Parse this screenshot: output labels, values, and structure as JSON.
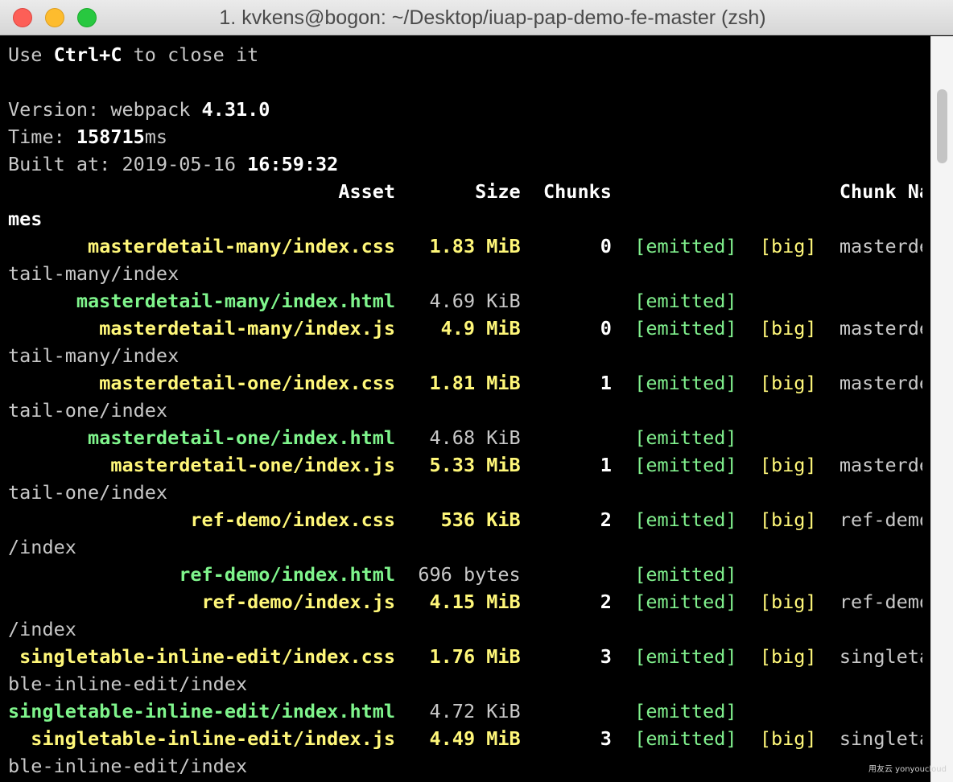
{
  "window": {
    "title": "1. kvkens@bogon: ~/Desktop/iuap-pap-demo-fe-master (zsh)"
  },
  "terminal": {
    "intro": {
      "pre": "Use ",
      "key": "Ctrl+C",
      "post": " to close it"
    },
    "version": {
      "label": "Version: webpack ",
      "value": "4.31.0"
    },
    "time": {
      "label": "Time: ",
      "value": "158715",
      "unit": "ms"
    },
    "built": {
      "label": "Built at: 2019-05-16 ",
      "value": "16:59:32"
    },
    "headers": {
      "asset": "Asset",
      "size": "Size",
      "chunks": "Chunks",
      "chunk_names": "Chunk Na",
      "chunk_names_wrap": "mes"
    },
    "rows": [
      {
        "asset": "masterdetail-many/index.css",
        "size": "1.83 MiB",
        "chunk": "0",
        "emitted": "[emitted]",
        "big": "[big]",
        "name": "masterde",
        "wrap": "tail-many/index",
        "type": "css"
      },
      {
        "asset": "masterdetail-many/index.html",
        "size": "4.69 KiB",
        "chunk": "",
        "emitted": "[emitted]",
        "big": "",
        "name": "",
        "wrap": "",
        "type": "html"
      },
      {
        "asset": "masterdetail-many/index.js",
        "size": "4.9 MiB",
        "chunk": "0",
        "emitted": "[emitted]",
        "big": "[big]",
        "name": "masterde",
        "wrap": "tail-many/index",
        "type": "js"
      },
      {
        "asset": "masterdetail-one/index.css",
        "size": "1.81 MiB",
        "chunk": "1",
        "emitted": "[emitted]",
        "big": "[big]",
        "name": "masterde",
        "wrap": "tail-one/index",
        "type": "css"
      },
      {
        "asset": "masterdetail-one/index.html",
        "size": "4.68 KiB",
        "chunk": "",
        "emitted": "[emitted]",
        "big": "",
        "name": "",
        "wrap": "",
        "type": "html"
      },
      {
        "asset": "masterdetail-one/index.js",
        "size": "5.33 MiB",
        "chunk": "1",
        "emitted": "[emitted]",
        "big": "[big]",
        "name": "masterde",
        "wrap": "tail-one/index",
        "type": "js"
      },
      {
        "asset": "ref-demo/index.css",
        "size": "536 KiB",
        "chunk": "2",
        "emitted": "[emitted]",
        "big": "[big]",
        "name": "ref-demo",
        "wrap": "/index",
        "type": "css"
      },
      {
        "asset": "ref-demo/index.html",
        "size": "696 bytes",
        "chunk": "",
        "emitted": "[emitted]",
        "big": "",
        "name": "",
        "wrap": "",
        "type": "html"
      },
      {
        "asset": "ref-demo/index.js",
        "size": "4.15 MiB",
        "chunk": "2",
        "emitted": "[emitted]",
        "big": "[big]",
        "name": "ref-demo",
        "wrap": "/index",
        "type": "js"
      },
      {
        "asset": "singletable-inline-edit/index.css",
        "size": "1.76 MiB",
        "chunk": "3",
        "emitted": "[emitted]",
        "big": "[big]",
        "name": "singleta",
        "wrap": "ble-inline-edit/index",
        "type": "css"
      },
      {
        "asset": "singletable-inline-edit/index.html",
        "size": "4.72 KiB",
        "chunk": "",
        "emitted": "[emitted]",
        "big": "",
        "name": "",
        "wrap": "",
        "type": "html"
      },
      {
        "asset": "singletable-inline-edit/index.js",
        "size": "4.49 MiB",
        "chunk": "3",
        "emitted": "[emitted]",
        "big": "[big]",
        "name": "singleta",
        "wrap": "ble-inline-edit/index",
        "type": "js"
      }
    ]
  },
  "watermark": "用友云 yonyoucloud",
  "colors": {
    "yellow": "#fff779",
    "green": "#7ff58c",
    "gray": "#c8c8c8",
    "white": "#ffffff",
    "background": "#000000"
  }
}
